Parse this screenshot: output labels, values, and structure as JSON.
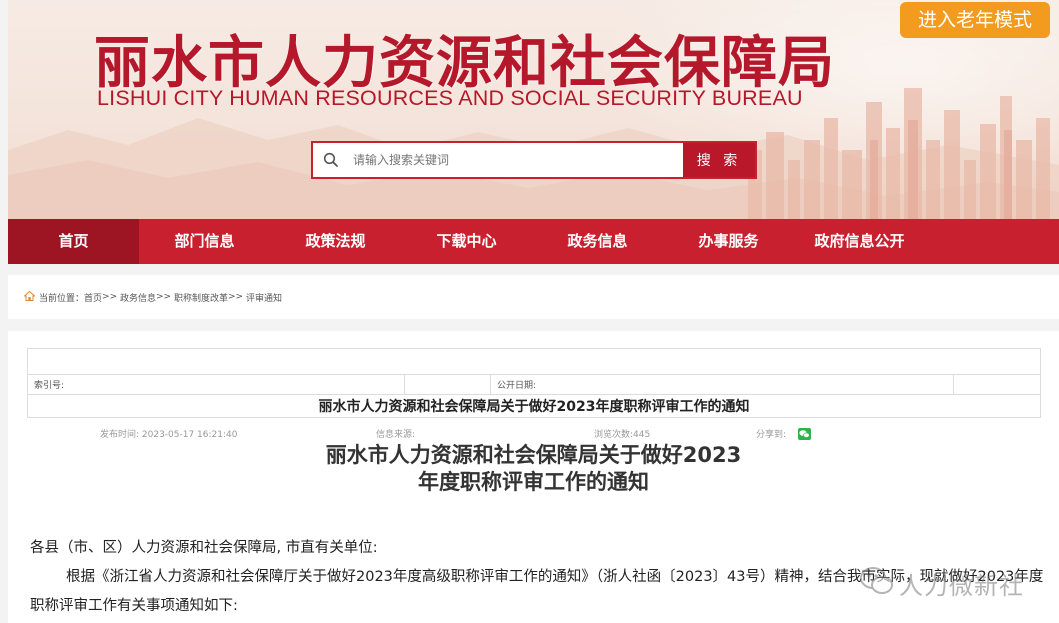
{
  "header": {
    "title": "丽水市人力资源和社会保障局",
    "subtitle": "LISHUI CITY HUMAN RESOURCES AND SOCIAL SECURITY BUREAU",
    "elder_mode_label": "进入老年模式",
    "brand_color": "#c8202e",
    "accent_color": "#f29b1e"
  },
  "search": {
    "placeholder": "请输入搜索关键词",
    "button_label": "搜 索",
    "icon": "search-icon"
  },
  "nav": {
    "items": [
      {
        "label": "首页",
        "active": true
      },
      {
        "label": "部门信息"
      },
      {
        "label": "政策法规"
      },
      {
        "label": "下载中心"
      },
      {
        "label": "政务信息"
      },
      {
        "label": "办事服务"
      },
      {
        "label": "政府信息公开"
      }
    ]
  },
  "breadcrumb": {
    "icon": "home-icon",
    "prefix": "当前位置：",
    "items": [
      "首页",
      "政务信息",
      "职称制度改革",
      "评审通知"
    ],
    "separator": ">>"
  },
  "meta": {
    "index_label": "索引号:",
    "index_value": "",
    "open_mode_label": "公开日期:",
    "open_mode_value": "",
    "doc_title": "丽水市人力资源和社会保障局关于做好2023年度职称评审工作的通知"
  },
  "info": {
    "publish_time": "发布时间: 2023-05-17 16:21:40",
    "source": "信息来源:",
    "views": "浏览次数:445",
    "share": "分享到:",
    "share_icon": "wechat-icon"
  },
  "article": {
    "title_line1": "丽水市人力资源和社会保障局关于做好2023",
    "title_line2": "年度职称评审工作的通知",
    "salutation": "各县（市、区）人力资源和社会保障局, 市直有关单位:",
    "paragraph": "根据《浙江省人力资源和社会保障厅关于做好2023年度高级职称评审工作的通知》（浙人社函〔2023〕43号）精神，结合我市实际，现就做好2023年度职称评审工作有关事项通知如下:"
  },
  "watermark": {
    "text": "人力微新社"
  }
}
